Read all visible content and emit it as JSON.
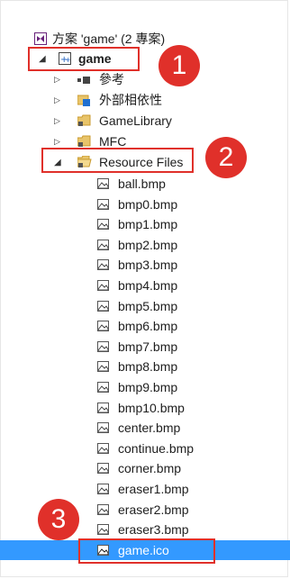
{
  "solution": {
    "title": "方案 'game' (2 專案)"
  },
  "project": {
    "name": "game",
    "children": [
      {
        "label": "參考"
      },
      {
        "label": "外部相依性"
      },
      {
        "label": "GameLibrary"
      },
      {
        "label": "MFC"
      }
    ]
  },
  "resource_files": {
    "label": "Resource Files",
    "files": [
      "ball.bmp",
      "bmp0.bmp",
      "bmp1.bmp",
      "bmp2.bmp",
      "bmp3.bmp",
      "bmp4.bmp",
      "bmp5.bmp",
      "bmp6.bmp",
      "bmp7.bmp",
      "bmp8.bmp",
      "bmp9.bmp",
      "bmp10.bmp",
      "center.bmp",
      "continue.bmp",
      "corner.bmp",
      "eraser1.bmp",
      "eraser2.bmp",
      "eraser3.bmp",
      "game.ico"
    ]
  },
  "callouts": {
    "one": "1",
    "two": "2",
    "three": "3"
  },
  "colors": {
    "accent_red": "#e0302a",
    "selection": "#3399ff"
  }
}
